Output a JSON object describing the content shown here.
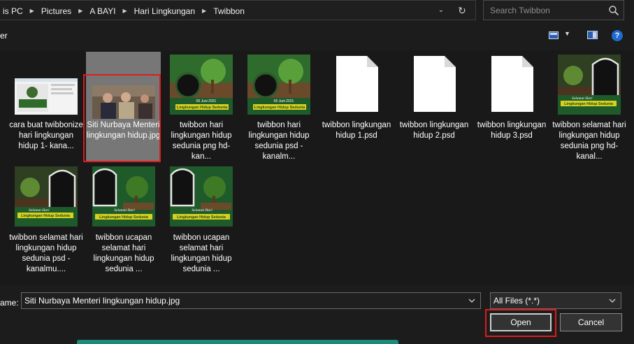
{
  "address_bar": {
    "crumbs": [
      "is PC",
      "Pictures",
      "A BAYI",
      "Hari Lingkungan",
      "Twibbon"
    ]
  },
  "search": {
    "placeholder": "Search Twibbon"
  },
  "toolbar": {
    "organize_label": "er"
  },
  "files": [
    {
      "name": "cara buat twibbonize hari lingkungan hidup 1- kana...",
      "kind": "image",
      "thumb": "screenshot"
    },
    {
      "name": "Siti Nurbaya Menteri lingkungan hidup.jpg",
      "kind": "image",
      "thumb": "photo",
      "selected": true
    },
    {
      "name": "twibbon hari lingkungan hidup sedunia png hd- kan...",
      "kind": "image",
      "thumb": "twibbon-round"
    },
    {
      "name": "twibbon hari lingkungan hidup sedunia psd - kanalm...",
      "kind": "image",
      "thumb": "twibbon-round"
    },
    {
      "name": "twibbon lingkungan hidup 1.psd",
      "kind": "document"
    },
    {
      "name": "twibbon lingkungan hidup 2.psd",
      "kind": "document"
    },
    {
      "name": "twibbon lingkungan hidup 3.psd",
      "kind": "document"
    },
    {
      "name": "twibbon selamat hari lingkungan hidup sedunia png hd- kanal...",
      "kind": "image",
      "thumb": "twibbon-arch"
    },
    {
      "name": "twibbon selamat hari lingkungan hidup sedunia psd - kanalmu....",
      "kind": "image",
      "thumb": "twibbon-arch"
    },
    {
      "name": "twibbon ucapan selamat hari lingkungan hidup sedunia ...",
      "kind": "image",
      "thumb": "twibbon-arch-green"
    },
    {
      "name": "twibbon ucapan selamat hari lingkungan hidup sedunia ...",
      "kind": "image",
      "thumb": "twibbon-arch-green"
    }
  ],
  "thumb_text": {
    "script": "Selamat Hari",
    "banner": "Lingkungan Hidup Sedunia",
    "date": "05 Juni 2021"
  },
  "bottom": {
    "filename_label": "ame:",
    "filename_value": "Siti Nurbaya Menteri lingkungan hidup.jpg",
    "filetype_value": "All Files (*.*)",
    "open_label": "Open",
    "cancel_label": "Cancel"
  },
  "colors": {
    "background": "#1c1c1c",
    "selected_tile": "#777777",
    "highlight": "#e01b1b",
    "help_icon": "#1e6bd1",
    "twibbon_green": "#1f5a2a",
    "banner_yellow": "#d8d020"
  }
}
